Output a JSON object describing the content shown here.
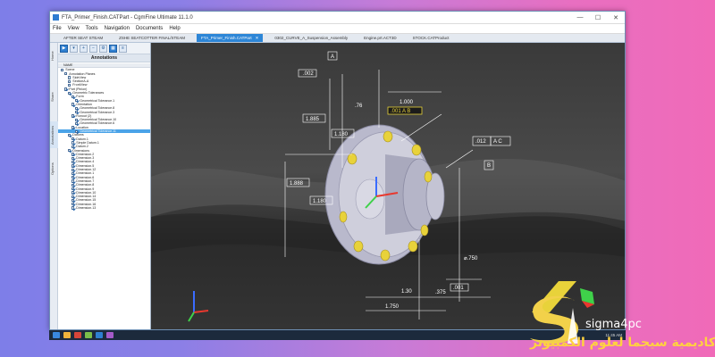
{
  "window": {
    "title": "FTA_Primer_Finish.CATPart - CgmFine Ultimate 11.1.0",
    "controls": {
      "minimize": "—",
      "maximize": "☐",
      "close": "✕"
    }
  },
  "menu": [
    "File",
    "View",
    "Tools",
    "Navigation",
    "Documents",
    "Help"
  ],
  "doc_tabs": [
    {
      "label": "AFTER SEAT STEAM",
      "active": false
    },
    {
      "label": "ZSHE SEATCOTTER FINAL/STEAM",
      "active": false
    },
    {
      "label": "FTA_Primer_Finish.CATPart",
      "active": true
    },
    {
      "label": "0302_CURVE_A_Suspension_Assembly",
      "active": false
    },
    {
      "label": "Engine.prt.ACT3D",
      "active": false
    },
    {
      "label": "STOCK.CATProduct",
      "active": false
    }
  ],
  "side_tabs": [
    "Home",
    "Share",
    "Annotations",
    "Options"
  ],
  "panel": {
    "title": "Annotations",
    "column_header": "NAME",
    "tree": [
      {
        "label": "Scene",
        "indent": 0,
        "checked": false,
        "selected": false
      },
      {
        "label": "Annotation Planes",
        "indent": 1,
        "checked": false,
        "selected": false
      },
      {
        "label": "SideView",
        "indent": 2,
        "checked": false,
        "selected": false
      },
      {
        "label": "SectionA-A",
        "indent": 2,
        "checked": false,
        "selected": false
      },
      {
        "label": "FrontView",
        "indent": 2,
        "checked": false,
        "selected": false
      },
      {
        "label": "Part (Pinion)",
        "indent": 1,
        "checked": true,
        "selected": false
      },
      {
        "label": "Geometric Tolerances",
        "indent": 2,
        "checked": true,
        "selected": false
      },
      {
        "label": "Form",
        "indent": 3,
        "checked": true,
        "selected": false
      },
      {
        "label": "Geometrical Tolerance.1",
        "indent": 4,
        "checked": true,
        "selected": false
      },
      {
        "label": "Orientation",
        "indent": 3,
        "checked": true,
        "selected": false
      },
      {
        "label": "Geometrical Tolerance.8",
        "indent": 4,
        "checked": true,
        "selected": false
      },
      {
        "label": "Geometrical Tolerance.3",
        "indent": 4,
        "checked": true,
        "selected": false
      },
      {
        "label": "Runout (2)",
        "indent": 3,
        "checked": true,
        "selected": false
      },
      {
        "label": "Geometrical Tolerance.10",
        "indent": 4,
        "checked": true,
        "selected": false
      },
      {
        "label": "Geometrical Tolerance.6",
        "indent": 4,
        "checked": true,
        "selected": false
      },
      {
        "label": "Location",
        "indent": 3,
        "checked": true,
        "selected": false
      },
      {
        "label": "Geometrical Tolerance.11",
        "indent": 4,
        "checked": true,
        "selected": true
      },
      {
        "label": "Datums",
        "indent": 2,
        "checked": true,
        "selected": false
      },
      {
        "label": "Datum.1",
        "indent": 3,
        "checked": true,
        "selected": false
      },
      {
        "label": "Simple Datum.1",
        "indent": 3,
        "checked": true,
        "selected": false
      },
      {
        "label": "Datum.2",
        "indent": 3,
        "checked": true,
        "selected": false
      },
      {
        "label": "Dimensions",
        "indent": 2,
        "checked": true,
        "selected": false
      },
      {
        "label": "Dimension.2",
        "indent": 3,
        "checked": true,
        "selected": false
      },
      {
        "label": "Dimension.3",
        "indent": 3,
        "checked": true,
        "selected": false
      },
      {
        "label": "Dimension.4",
        "indent": 3,
        "checked": true,
        "selected": false
      },
      {
        "label": "Dimension.5",
        "indent": 3,
        "checked": true,
        "selected": false
      },
      {
        "label": "Dimension.12",
        "indent": 3,
        "checked": true,
        "selected": false
      },
      {
        "label": "Dimension.1",
        "indent": 3,
        "checked": true,
        "selected": false
      },
      {
        "label": "Dimension.6",
        "indent": 3,
        "checked": true,
        "selected": false
      },
      {
        "label": "Dimension.7",
        "indent": 3,
        "checked": true,
        "selected": false
      },
      {
        "label": "Dimension.8",
        "indent": 3,
        "checked": true,
        "selected": false
      },
      {
        "label": "Dimension.9",
        "indent": 3,
        "checked": true,
        "selected": false
      },
      {
        "label": "Dimension.10",
        "indent": 3,
        "checked": true,
        "selected": false
      },
      {
        "label": "Dimension.14",
        "indent": 3,
        "checked": true,
        "selected": false
      },
      {
        "label": "Dimension.15",
        "indent": 3,
        "checked": true,
        "selected": false
      },
      {
        "label": "Dimension.16",
        "indent": 3,
        "checked": true,
        "selected": false
      },
      {
        "label": "Dimension.13",
        "indent": 3,
        "checked": true,
        "selected": false
      }
    ]
  },
  "viewport": {
    "dimensions": {
      "d_002": ".002",
      "d_a": "A",
      "d_1000": "1.000",
      "d_tol": ".001 A B",
      "d_76": ".76",
      "d_1885": "1.885",
      "d_1180": "1.180",
      "d_1888": "1.888",
      "d_1180b": "1.180",
      "d_012": ".012",
      "d_ac": "A  C",
      "d_b": "B",
      "d_750": "⌀.750",
      "d_001b": ".001",
      "d_130": "1.30",
      "d_375": ".375",
      "d_1750": "1.750"
    },
    "colors": {
      "flange": "#c8c8d6",
      "hole": "#e8d23a",
      "dim_line": "#ffffff"
    }
  },
  "taskbar": {
    "time": "11:45 AM"
  },
  "brand": {
    "name": "sigma4pc",
    "arabic": "أكاديمية سيجما لعلوم الكمبيوتر"
  }
}
